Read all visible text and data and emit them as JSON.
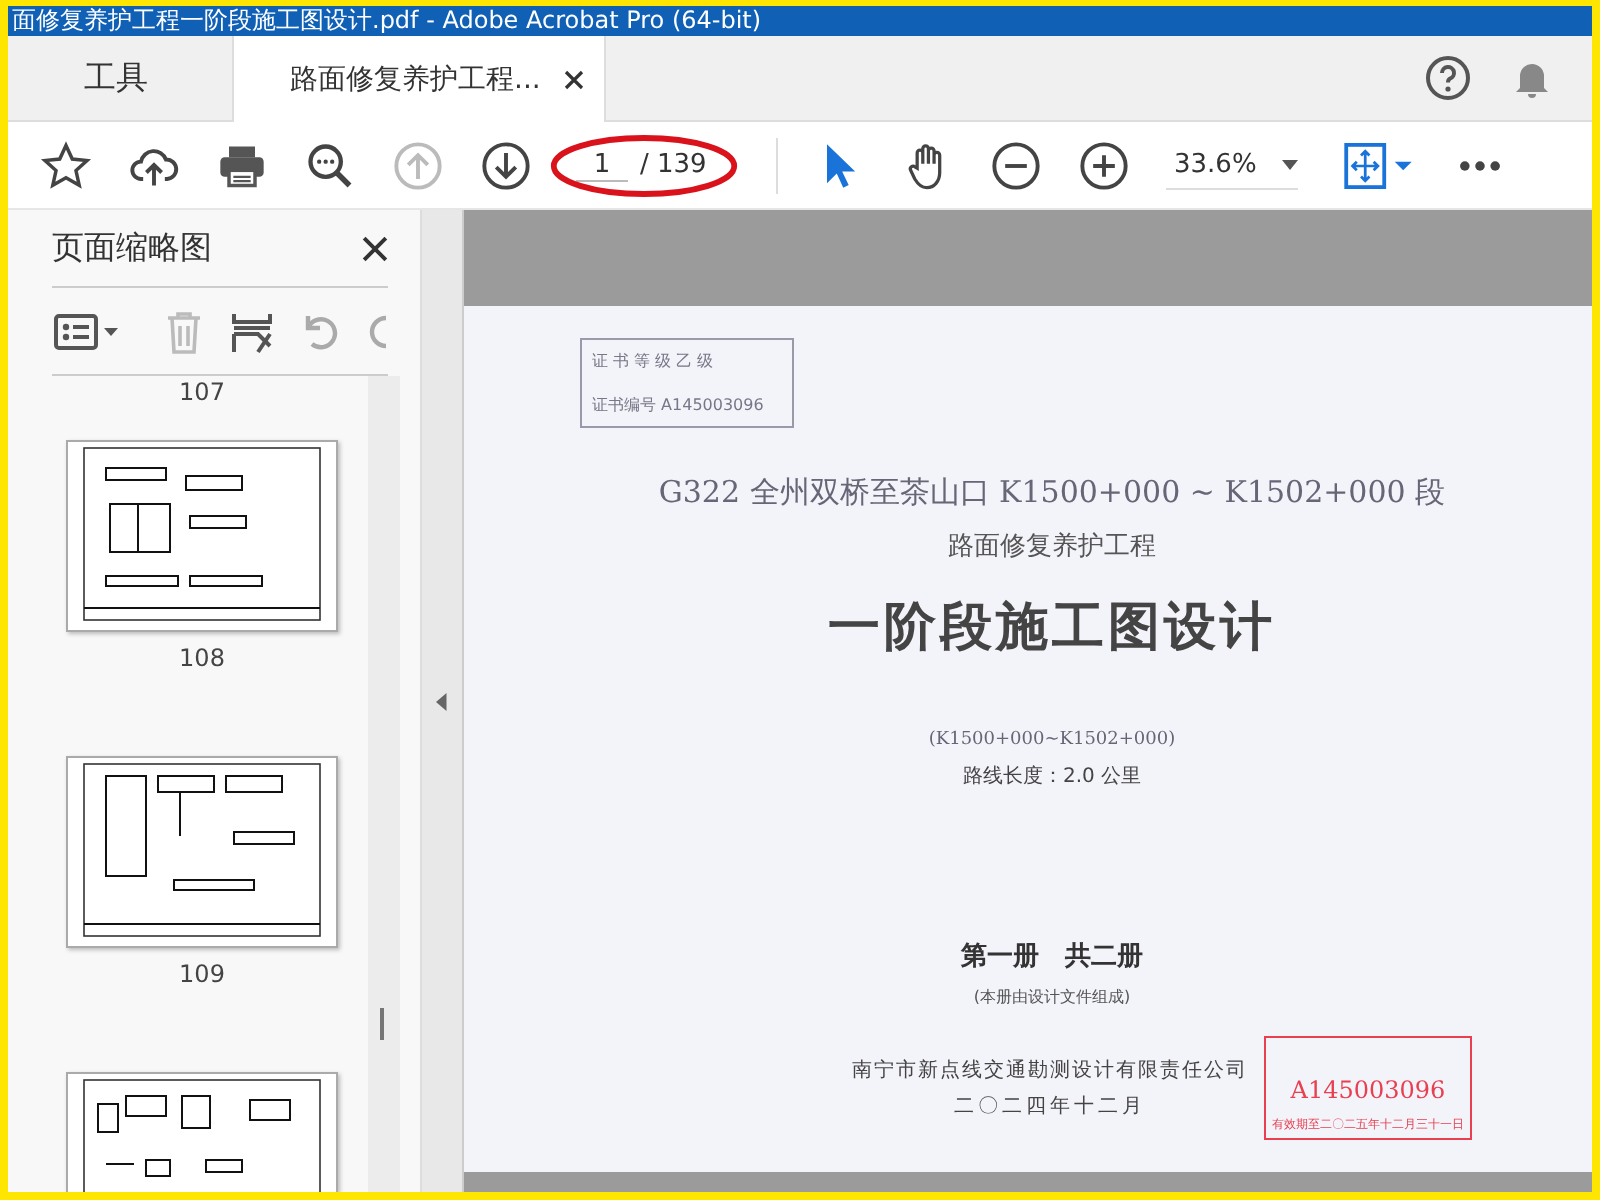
{
  "window": {
    "title": "面修复养护工程一阶段施工图设计.pdf - Adobe Acrobat Pro (64-bit)"
  },
  "tabs": [
    {
      "label": "工具",
      "selected": false,
      "closable": false
    },
    {
      "label": "路面修复养护工程...",
      "selected": true,
      "closable": true
    }
  ],
  "toolbar": {
    "page_current": "1",
    "page_total": "/ 139",
    "zoom": "33.6%",
    "prev_disabled": true
  },
  "sidebar": {
    "title": "页面缩略图",
    "thumbnails": [
      {
        "kind": "label",
        "label": "107"
      },
      {
        "kind": "full",
        "label": "108"
      },
      {
        "kind": "full",
        "label": "109"
      },
      {
        "kind": "top"
      }
    ]
  },
  "document": {
    "certificate": [
      "证 书 等 级 乙 级",
      "证书编号 A145003096"
    ],
    "heading": "G322 全州双桥至茶山口 K1500+000 ~ K1502+000 段",
    "subtitle": "路面修复养护工程",
    "title": "一阶段施工图设计",
    "range": "(K1500+000~K1502+000)",
    "length": "路线长度：2.0 公里",
    "volume": "第一册　共二册",
    "volume_note": "(本册由设计文件组成)",
    "company": "南宁市新点线交通勘测设计有限责任公司",
    "date": "二〇二四年十二月",
    "stamp": [
      "A145003096",
      "有效期至二〇二五年十二月三十一日"
    ]
  }
}
